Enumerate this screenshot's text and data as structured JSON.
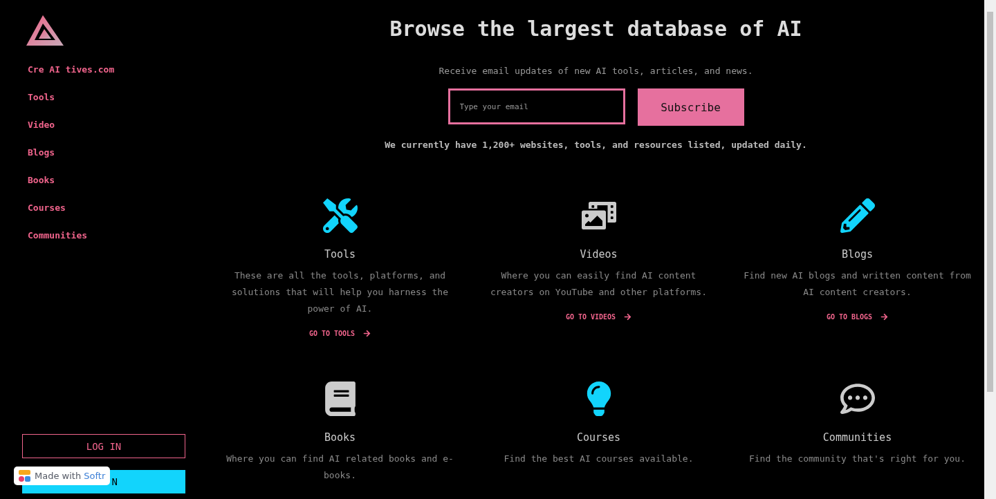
{
  "sidebar": {
    "nav": [
      {
        "label": "Cre AI tives.com"
      },
      {
        "label": "Tools"
      },
      {
        "label": "Video"
      },
      {
        "label": "Blogs"
      },
      {
        "label": "Books"
      },
      {
        "label": "Courses"
      },
      {
        "label": "Communities"
      }
    ],
    "login_button": "LOG IN",
    "signup_button": "N"
  },
  "header": {
    "title": "Browse the largest database of AI",
    "subtitle": "Receive email updates of new AI tools, articles, and news.",
    "email": {
      "placeholder": "Type your email"
    },
    "subscribe_button": "Subscribe",
    "note": "We currently have 1,200+ websites, tools, and resources listed, updated daily."
  },
  "cards": [
    {
      "kind": "tools",
      "color": "#12d4fc",
      "title": "Tools",
      "text": "These are all the tools, platforms, and solutions that will help you harness the power of AI.",
      "link": "GO TO TOOLS"
    },
    {
      "kind": "videos",
      "color": "#cccccc",
      "title": "Videos",
      "text": "Where you can easily find AI content creators on YouTube and other platforms.",
      "link": "GO TO VIDEOS"
    },
    {
      "kind": "blogs",
      "color": "#12d4fc",
      "title": "Blogs",
      "text": "Find new AI blogs and written content from AI content creators.",
      "link": "GO TO BLOGS"
    },
    {
      "kind": "books",
      "color": "#cccccc",
      "title": "Books",
      "text": "Where you can find AI related books and e-books."
    },
    {
      "kind": "courses",
      "color": "#12d4fc",
      "title": "Courses",
      "text": "Find the best AI courses available."
    },
    {
      "kind": "communities",
      "color": "#cccccc",
      "title": "Communities",
      "text": "Find the community that's right for you."
    }
  ],
  "badge": {
    "text": "Made with ",
    "brand": "Softr"
  }
}
